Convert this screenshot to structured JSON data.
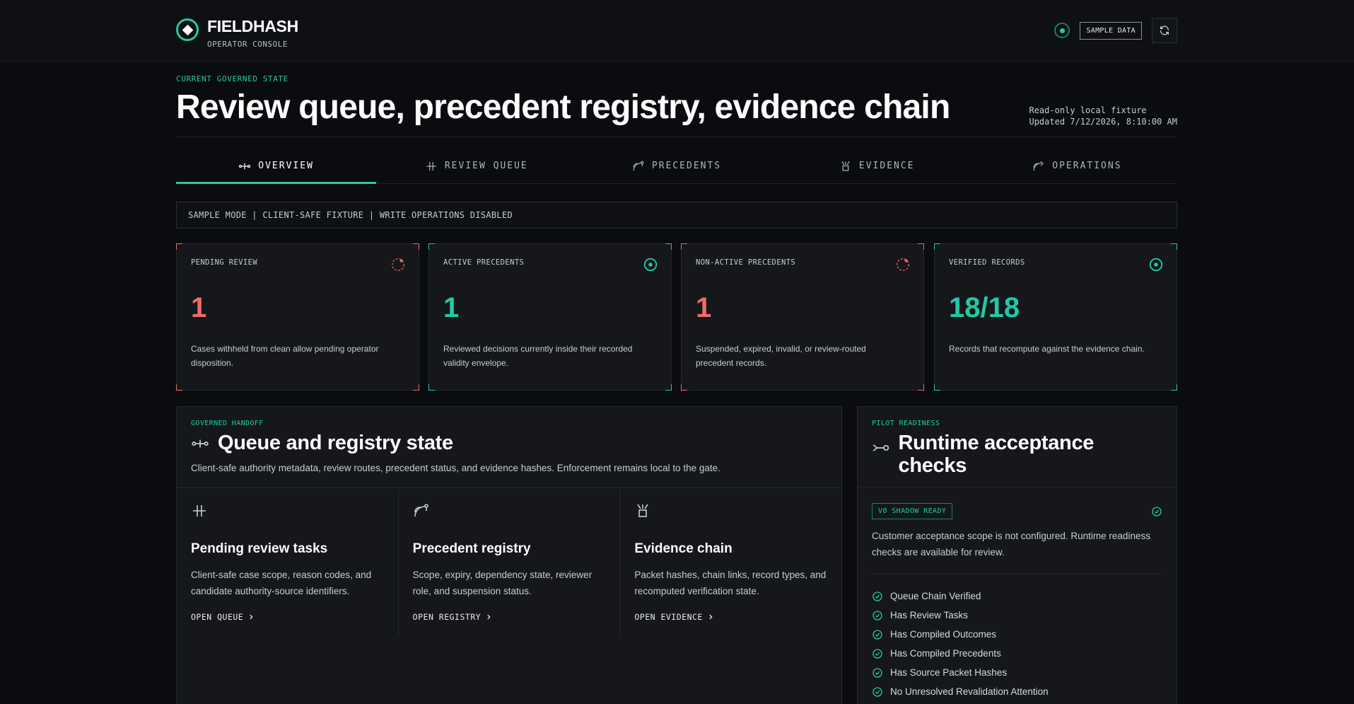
{
  "brand": {
    "title": "FIELDHASH",
    "subtitle": "OPERATOR CONSOLE"
  },
  "topbar": {
    "sample_badge": "SAMPLE DATA"
  },
  "header": {
    "eyebrow": "CURRENT GOVERNED STATE",
    "title": "Review queue, precedent registry, evidence chain",
    "meta_line1": "Read-only local fixture",
    "meta_line2": "Updated 7/12/2026, 8:10:00 AM"
  },
  "tabs": [
    {
      "label": "OVERVIEW",
      "icon": "route-icon",
      "active": true
    },
    {
      "label": "REVIEW QUEUE",
      "icon": "queue-icon",
      "active": false
    },
    {
      "label": "PRECEDENTS",
      "icon": "precedent-icon",
      "active": false
    },
    {
      "label": "EVIDENCE",
      "icon": "evidence-icon",
      "active": false
    },
    {
      "label": "OPERATIONS",
      "icon": "operations-icon",
      "active": false
    }
  ],
  "notice": "SAMPLE MODE | CLIENT-SAFE FIXTURE | WRITE OPERATIONS DISABLED",
  "stats": [
    {
      "label": "PENDING REVIEW",
      "value": "1",
      "desc": "Cases withheld from clean allow pending operator disposition.",
      "color": "#f06a6a",
      "icon": "alert-ring-icon"
    },
    {
      "label": "ACTIVE PRECEDENTS",
      "value": "1",
      "desc": "Reviewed decisions currently inside their recorded validity envelope.",
      "color": "#22c9a5",
      "icon": "status-ring-icon"
    },
    {
      "label": "NON-ACTIVE PRECEDENTS",
      "value": "1",
      "desc": "Suspended, expired, invalid, or review-routed precedent records.",
      "color": "#f06a6a",
      "icon": "alert-ring-icon"
    },
    {
      "label": "VERIFIED RECORDS",
      "value": "18/18",
      "desc": "Records that recompute against the evidence chain.",
      "color": "#22c9a5",
      "icon": "status-ring-icon"
    }
  ],
  "handoff": {
    "eyebrow": "GOVERNED HANDOFF",
    "title": "Queue and registry state",
    "subtitle": "Client-safe authority metadata, review routes, precedent status, and evidence hashes. Enforcement remains local to the gate.",
    "columns": [
      {
        "title": "Pending review tasks",
        "desc": "Client-safe case scope, reason codes, and candidate authority-source identifiers.",
        "link": "OPEN QUEUE"
      },
      {
        "title": "Precedent registry",
        "desc": "Scope, expiry, dependency state, reviewer role, and suspension status.",
        "link": "OPEN REGISTRY"
      },
      {
        "title": "Evidence chain",
        "desc": "Packet hashes, chain links, record types, and recomputed verification state.",
        "link": "OPEN EVIDENCE"
      }
    ]
  },
  "pilot": {
    "eyebrow": "PILOT READINESS",
    "title": "Runtime acceptance checks",
    "badge": "V0 SHADOW READY",
    "desc": "Customer acceptance scope is not configured. Runtime readiness checks are available for review.",
    "checks": [
      "Queue Chain Verified",
      "Has Review Tasks",
      "Has Compiled Outcomes",
      "Has Compiled Precedents",
      "Has Source Packet Hashes",
      "No Unresolved Revalidation Attention"
    ]
  },
  "colors": {
    "accent": "#22c9a5",
    "danger": "#f06a6a",
    "background": "#0b0c0f",
    "panel": "#15171b"
  }
}
